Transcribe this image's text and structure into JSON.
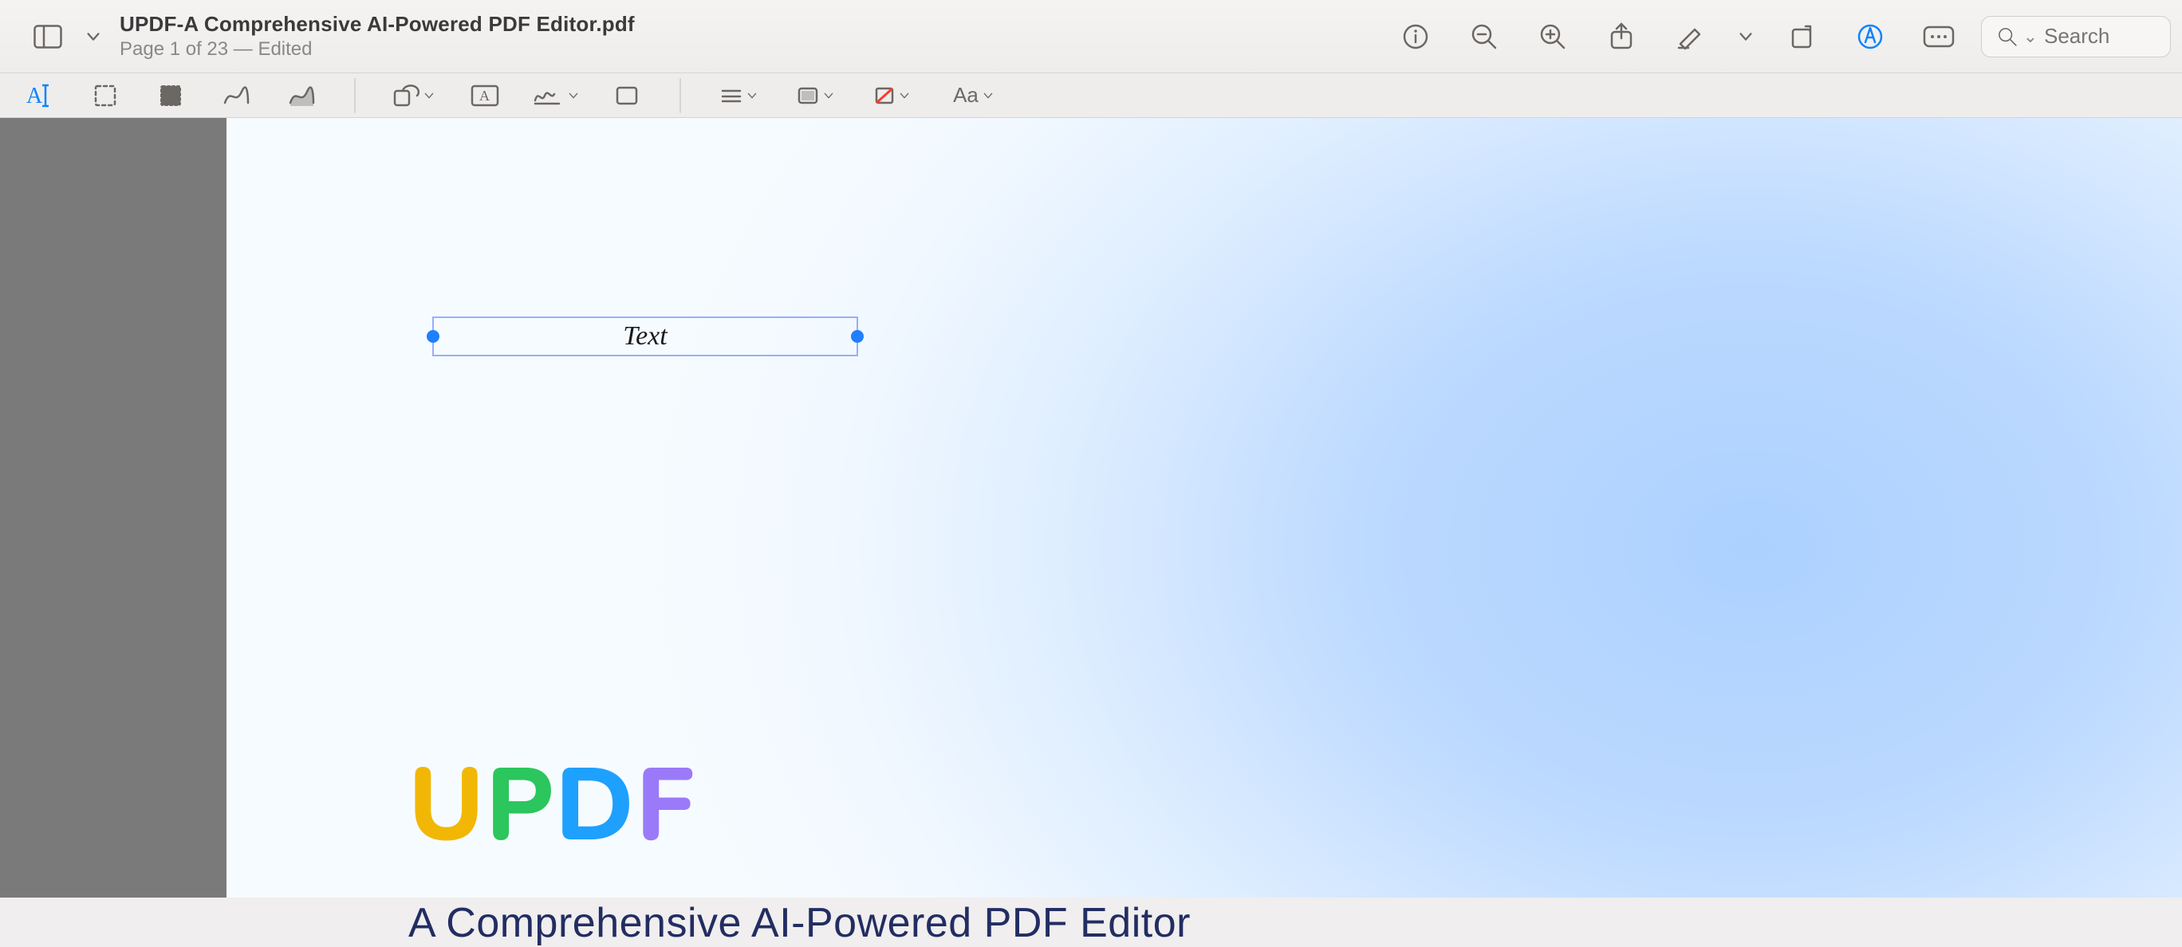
{
  "header": {
    "title": "UPDF-A Comprehensive AI-Powered PDF Editor.pdf",
    "subtitle": "Page 1 of 23  —  Edited",
    "search_placeholder": "Search"
  },
  "tools": {
    "font_label": "Aa"
  },
  "page": {
    "textbox_value": "Text",
    "logo_letters": {
      "u": "U",
      "p": "P",
      "d": "D",
      "f": "F"
    },
    "tagline": "A Comprehensive AI-Powered PDF Editor"
  }
}
